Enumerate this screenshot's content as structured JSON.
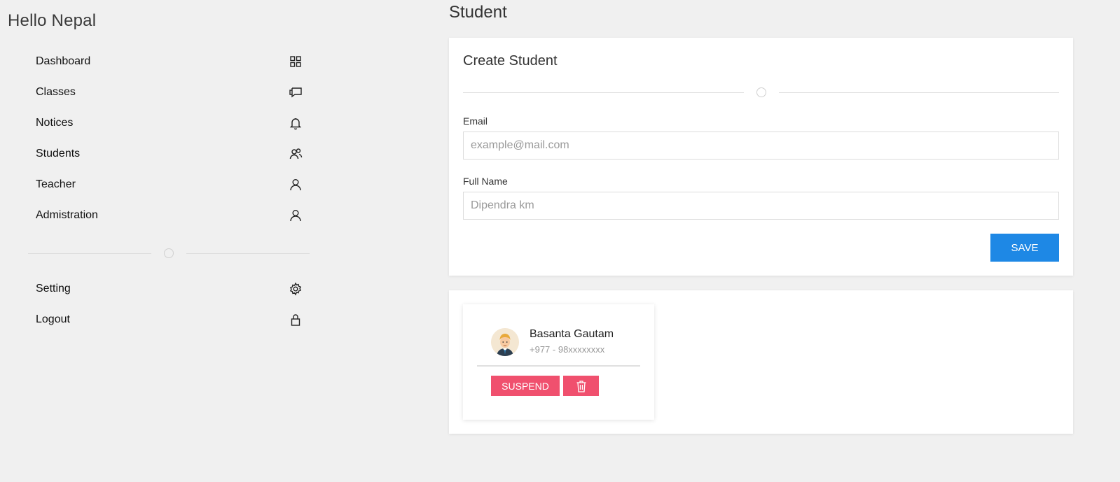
{
  "app": {
    "brand": "Hello Nepal"
  },
  "sidebar": {
    "items": [
      {
        "label": "Dashboard",
        "icon": "grid-icon"
      },
      {
        "label": "Classes",
        "icon": "chat-icon"
      },
      {
        "label": "Notices",
        "icon": "bell-icon"
      },
      {
        "label": "Students",
        "icon": "users-icon"
      },
      {
        "label": "Teacher",
        "icon": "user-icon"
      },
      {
        "label": "Admistration",
        "icon": "user-icon"
      }
    ],
    "secondary_items": [
      {
        "label": "Setting",
        "icon": "gear-icon"
      },
      {
        "label": "Logout",
        "icon": "lock-icon"
      }
    ]
  },
  "page": {
    "title": "Student"
  },
  "form": {
    "title": "Create Student",
    "email_label": "Email",
    "email_placeholder": "example@mail.com",
    "email_value": "",
    "name_label": "Full Name",
    "name_placeholder": "Dipendra km",
    "name_value": "",
    "save_label": "SAVE"
  },
  "students": [
    {
      "name": "Basanta Gautam",
      "phone": "+977 - 98xxxxxxxx",
      "suspend_label": "SUSPEND",
      "delete_icon": "trash-icon"
    }
  ],
  "colors": {
    "primary": "#1e88e5",
    "danger": "#f0506e",
    "background": "#f0f0f0"
  }
}
